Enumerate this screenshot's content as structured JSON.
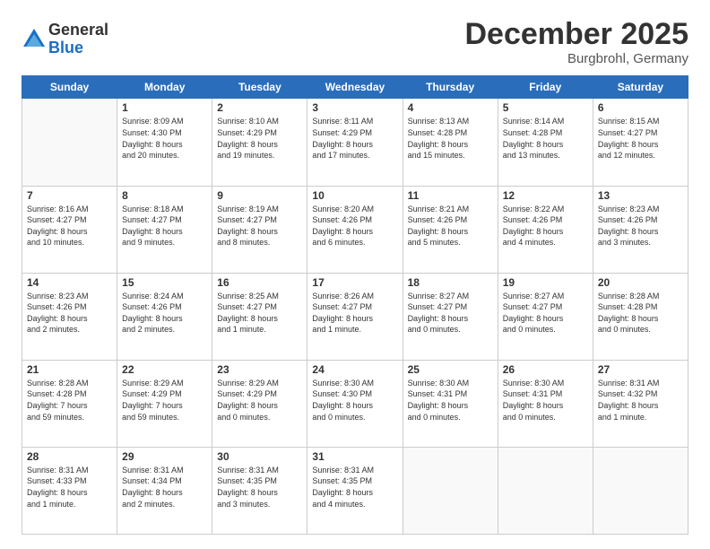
{
  "logo": {
    "general": "General",
    "blue": "Blue"
  },
  "header": {
    "month": "December 2025",
    "location": "Burgbrohl, Germany"
  },
  "weekdays": [
    "Sunday",
    "Monday",
    "Tuesday",
    "Wednesday",
    "Thursday",
    "Friday",
    "Saturday"
  ],
  "weeks": [
    [
      {
        "day": "",
        "info": ""
      },
      {
        "day": "1",
        "info": "Sunrise: 8:09 AM\nSunset: 4:30 PM\nDaylight: 8 hours\nand 20 minutes."
      },
      {
        "day": "2",
        "info": "Sunrise: 8:10 AM\nSunset: 4:29 PM\nDaylight: 8 hours\nand 19 minutes."
      },
      {
        "day": "3",
        "info": "Sunrise: 8:11 AM\nSunset: 4:29 PM\nDaylight: 8 hours\nand 17 minutes."
      },
      {
        "day": "4",
        "info": "Sunrise: 8:13 AM\nSunset: 4:28 PM\nDaylight: 8 hours\nand 15 minutes."
      },
      {
        "day": "5",
        "info": "Sunrise: 8:14 AM\nSunset: 4:28 PM\nDaylight: 8 hours\nand 13 minutes."
      },
      {
        "day": "6",
        "info": "Sunrise: 8:15 AM\nSunset: 4:27 PM\nDaylight: 8 hours\nand 12 minutes."
      }
    ],
    [
      {
        "day": "7",
        "info": "Sunrise: 8:16 AM\nSunset: 4:27 PM\nDaylight: 8 hours\nand 10 minutes."
      },
      {
        "day": "8",
        "info": "Sunrise: 8:18 AM\nSunset: 4:27 PM\nDaylight: 8 hours\nand 9 minutes."
      },
      {
        "day": "9",
        "info": "Sunrise: 8:19 AM\nSunset: 4:27 PM\nDaylight: 8 hours\nand 8 minutes."
      },
      {
        "day": "10",
        "info": "Sunrise: 8:20 AM\nSunset: 4:26 PM\nDaylight: 8 hours\nand 6 minutes."
      },
      {
        "day": "11",
        "info": "Sunrise: 8:21 AM\nSunset: 4:26 PM\nDaylight: 8 hours\nand 5 minutes."
      },
      {
        "day": "12",
        "info": "Sunrise: 8:22 AM\nSunset: 4:26 PM\nDaylight: 8 hours\nand 4 minutes."
      },
      {
        "day": "13",
        "info": "Sunrise: 8:23 AM\nSunset: 4:26 PM\nDaylight: 8 hours\nand 3 minutes."
      }
    ],
    [
      {
        "day": "14",
        "info": "Sunrise: 8:23 AM\nSunset: 4:26 PM\nDaylight: 8 hours\nand 2 minutes."
      },
      {
        "day": "15",
        "info": "Sunrise: 8:24 AM\nSunset: 4:26 PM\nDaylight: 8 hours\nand 2 minutes."
      },
      {
        "day": "16",
        "info": "Sunrise: 8:25 AM\nSunset: 4:27 PM\nDaylight: 8 hours\nand 1 minute."
      },
      {
        "day": "17",
        "info": "Sunrise: 8:26 AM\nSunset: 4:27 PM\nDaylight: 8 hours\nand 1 minute."
      },
      {
        "day": "18",
        "info": "Sunrise: 8:27 AM\nSunset: 4:27 PM\nDaylight: 8 hours\nand 0 minutes."
      },
      {
        "day": "19",
        "info": "Sunrise: 8:27 AM\nSunset: 4:27 PM\nDaylight: 8 hours\nand 0 minutes."
      },
      {
        "day": "20",
        "info": "Sunrise: 8:28 AM\nSunset: 4:28 PM\nDaylight: 8 hours\nand 0 minutes."
      }
    ],
    [
      {
        "day": "21",
        "info": "Sunrise: 8:28 AM\nSunset: 4:28 PM\nDaylight: 7 hours\nand 59 minutes."
      },
      {
        "day": "22",
        "info": "Sunrise: 8:29 AM\nSunset: 4:29 PM\nDaylight: 7 hours\nand 59 minutes."
      },
      {
        "day": "23",
        "info": "Sunrise: 8:29 AM\nSunset: 4:29 PM\nDaylight: 8 hours\nand 0 minutes."
      },
      {
        "day": "24",
        "info": "Sunrise: 8:30 AM\nSunset: 4:30 PM\nDaylight: 8 hours\nand 0 minutes."
      },
      {
        "day": "25",
        "info": "Sunrise: 8:30 AM\nSunset: 4:31 PM\nDaylight: 8 hours\nand 0 minutes."
      },
      {
        "day": "26",
        "info": "Sunrise: 8:30 AM\nSunset: 4:31 PM\nDaylight: 8 hours\nand 0 minutes."
      },
      {
        "day": "27",
        "info": "Sunrise: 8:31 AM\nSunset: 4:32 PM\nDaylight: 8 hours\nand 1 minute."
      }
    ],
    [
      {
        "day": "28",
        "info": "Sunrise: 8:31 AM\nSunset: 4:33 PM\nDaylight: 8 hours\nand 1 minute."
      },
      {
        "day": "29",
        "info": "Sunrise: 8:31 AM\nSunset: 4:34 PM\nDaylight: 8 hours\nand 2 minutes."
      },
      {
        "day": "30",
        "info": "Sunrise: 8:31 AM\nSunset: 4:35 PM\nDaylight: 8 hours\nand 3 minutes."
      },
      {
        "day": "31",
        "info": "Sunrise: 8:31 AM\nSunset: 4:35 PM\nDaylight: 8 hours\nand 4 minutes."
      },
      {
        "day": "",
        "info": ""
      },
      {
        "day": "",
        "info": ""
      },
      {
        "day": "",
        "info": ""
      }
    ]
  ]
}
